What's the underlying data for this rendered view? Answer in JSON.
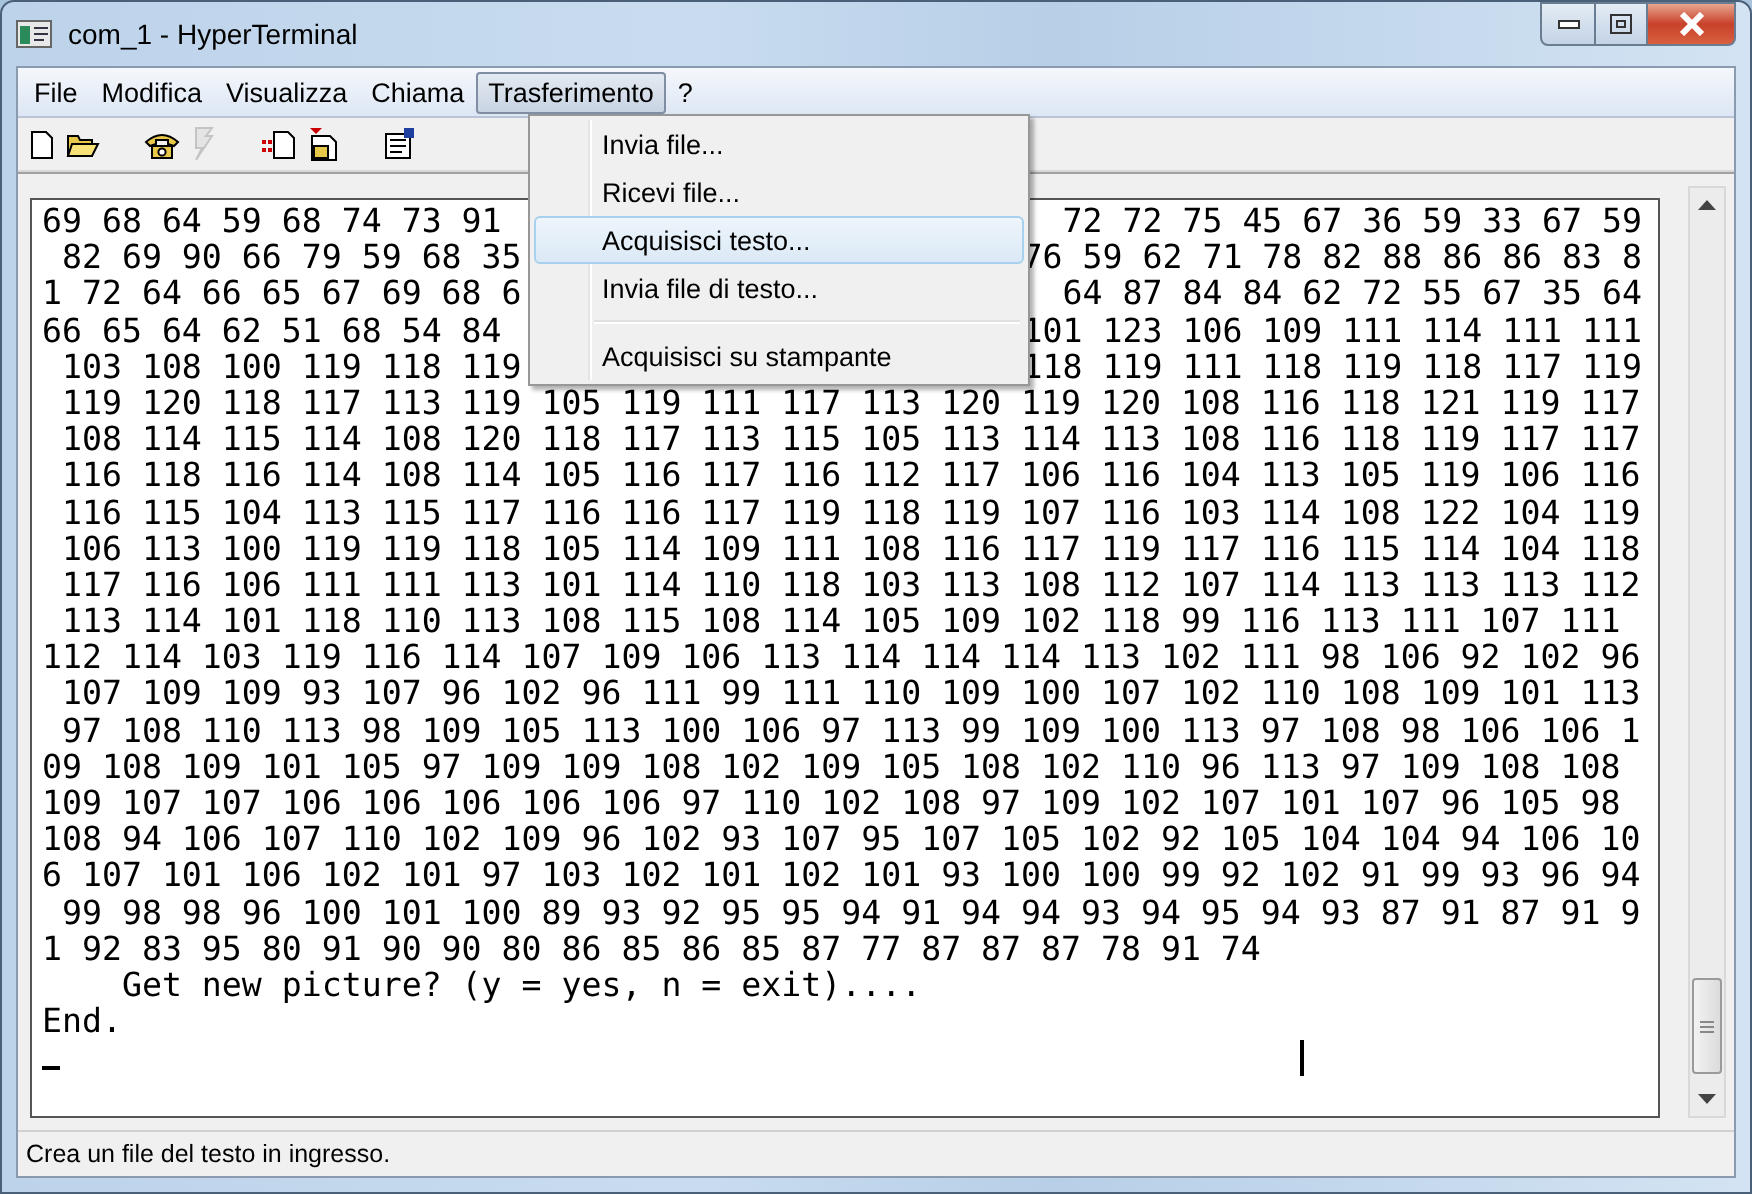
{
  "window": {
    "title": "com_1 - HyperTerminal"
  },
  "menu_bar": [
    {
      "label": "File",
      "selected": false
    },
    {
      "label": "Modifica",
      "selected": false
    },
    {
      "label": "Visualizza",
      "selected": false
    },
    {
      "label": "Chiama",
      "selected": false
    },
    {
      "label": "Trasferimento",
      "selected": true
    },
    {
      "label": "?",
      "selected": false
    }
  ],
  "toolbar": [
    {
      "kind": "new",
      "disabled": false
    },
    {
      "kind": "open",
      "disabled": false
    },
    {
      "kind": "call",
      "disabled": false
    },
    {
      "kind": "hangup",
      "disabled": true
    },
    {
      "kind": "send",
      "disabled": false
    },
    {
      "kind": "receive",
      "disabled": false
    },
    {
      "kind": "properties",
      "disabled": false
    }
  ],
  "dropdown": {
    "items": [
      {
        "kind": "item",
        "label": "Invia file...",
        "selected": false
      },
      {
        "kind": "item",
        "label": "Ricevi file...",
        "selected": false
      },
      {
        "kind": "item",
        "label": "Acquisisci testo...",
        "selected": true
      },
      {
        "kind": "item",
        "label": "Invia file di testo...",
        "selected": false
      },
      {
        "kind": "separator"
      },
      {
        "kind": "item",
        "label": "Acquisisci su stampante",
        "selected": false
      }
    ]
  },
  "terminal": {
    "lines": [
      {
        "left": "69 68 64 59 68 74 73 91",
        "right": "72 72 75 45 67 36 59 33 67 59"
      },
      {
        "left": " 82 69 90 66 79 59 68 35",
        "right": "76 59 62 71 78 82 88 86 86 83 8"
      },
      {
        "left": "1 72 64 66 65 67 69 68 6",
        "right": "64 87 84 84 62 72 55 67 35 64"
      },
      {
        "left": "66 65 64 62 51 68 54 84",
        "right": "101 123 106 109 111 114 111 111"
      },
      {
        "left": " 103 108 100 119 118 119",
        "right": "118 119 111 118 119 118 117 119"
      },
      {
        "text": " 119 120 118 117 113 119 105 119 111 117 113 120 119 120 108 116 118 121 119 117"
      },
      {
        "text": " 108 114 115 114 108 120 118 117 113 115 105 113 114 113 108 116 118 119 117 117"
      },
      {
        "text": " 116 118 116 114 108 114 105 116 117 116 112 117 106 116 104 113 105 119 106 116"
      },
      {
        "text": " 116 115 104 113 115 117 116 116 117 119 118 119 107 116 103 114 108 122 104 119"
      },
      {
        "text": " 106 113 100 119 119 118 105 114 109 111 108 116 117 119 117 116 115 114 104 118"
      },
      {
        "text": " 117 116 106 111 111 113 101 114 110 118 103 113 108 112 107 114 113 113 113 112"
      },
      {
        "text": " 113 114 101 118 110 113 108 115 108 114 105 109 102 118 99 116 113 111 107 111"
      },
      {
        "text": "112 114 103 119 116 114 107 109 106 113 114 114 114 113 102 111 98 106 92 102 96"
      },
      {
        "text": " 107 109 109 93 107 96 102 96 111 99 111 110 109 100 107 102 110 108 109 101 113"
      },
      {
        "text": " 97 108 110 113 98 109 105 113 100 106 97 113 99 109 100 113 97 108 98 106 106 1"
      },
      {
        "text": "09 108 109 101 105 97 109 109 108 102 109 105 108 102 110 96 113 97 109 108 108"
      },
      {
        "text": "109 107 107 106 106 106 106 106 97 110 102 108 97 109 102 107 101 107 96 105 98"
      },
      {
        "text": "108 94 106 107 110 102 109 96 102 93 107 95 107 105 102 92 105 104 104 94 106 10"
      },
      {
        "text": "6 107 101 106 102 101 97 103 102 101 102 101 93 100 100 99 92 102 91 99 93 96 94"
      },
      {
        "text": " 99 98 98 96 100 101 100 89 93 92 95 95 94 91 94 94 93 94 95 94 93 87 91 87 91 9"
      },
      {
        "text": "1 92 83 95 80 91 90 90 80 86 85 86 85 87 77 87 87 87 78 91 74"
      },
      {
        "text": "    Get new picture? (y = yes, n = exit)...."
      },
      {
        "text": "End."
      }
    ]
  },
  "status_bar": "Crea un file del testo in ingresso."
}
